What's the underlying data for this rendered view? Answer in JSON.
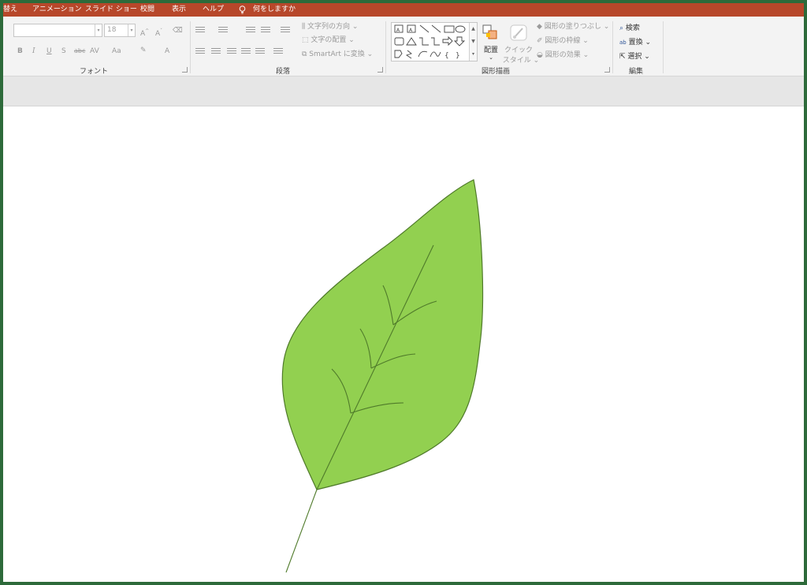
{
  "menubar": {
    "items": [
      "替え",
      "アニメーション",
      "スライド ショー",
      "校閲",
      "表示",
      "ヘルプ"
    ],
    "tell_me": "何をしますか",
    "color": "#b7472a"
  },
  "font_group": {
    "label": "フォント",
    "font_name": "",
    "font_size": "18",
    "buttons": [
      "B",
      "I",
      "U",
      "S",
      "abc",
      "AV",
      "Aa",
      "A"
    ]
  },
  "paragraph_group": {
    "label": "段落",
    "text_direction": "文字列の方向",
    "align_text": "文字の配置",
    "smartart": "SmartArt に変換"
  },
  "drawing_group": {
    "label": "図形描画",
    "arrange": "配置",
    "quick_styles_line1": "クイック",
    "quick_styles_line2": "スタイル",
    "shape_fill": "図形の塗りつぶし",
    "shape_outline": "図形の枠線",
    "shape_effects": "図形の効果"
  },
  "editing_group": {
    "label": "編集",
    "find": "検索",
    "replace": "置換",
    "select": "選択"
  },
  "slide": {
    "leaf_fill": "#92d050",
    "leaf_stroke": "#4f7a2a"
  }
}
